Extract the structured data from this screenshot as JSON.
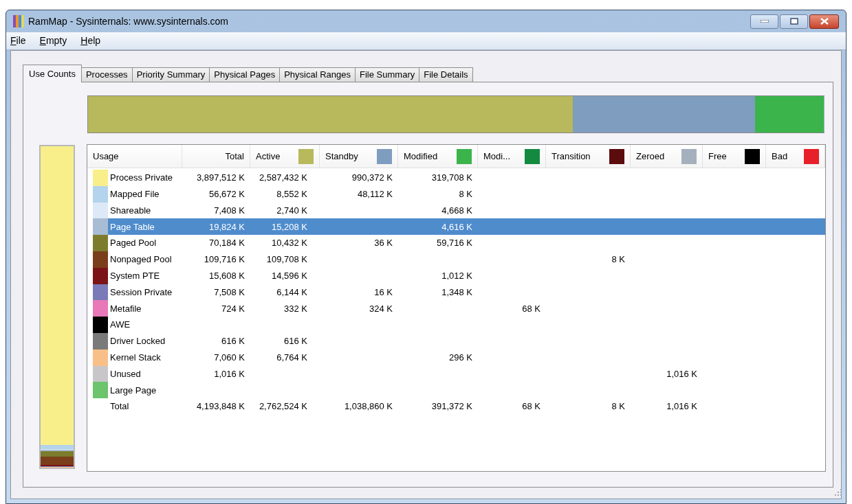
{
  "window": {
    "title": "RamMap - Sysinternals: www.sysinternals.com"
  },
  "menu": [
    "File",
    "Empty",
    "Help"
  ],
  "tabs": [
    {
      "label": "Use Counts",
      "selected": true
    },
    {
      "label": "Processes",
      "selected": false
    },
    {
      "label": "Priority Summary",
      "selected": false
    },
    {
      "label": "Physical Pages",
      "selected": false
    },
    {
      "label": "Physical Ranges",
      "selected": false
    },
    {
      "label": "File Summary",
      "selected": false
    },
    {
      "label": "File Details",
      "selected": false
    }
  ],
  "table": {
    "columns": [
      {
        "label": "Usage"
      },
      {
        "label": "Total"
      },
      {
        "label": "Active",
        "color": "#b8b85c"
      },
      {
        "label": "Standby",
        "color": "#7f9dbf"
      },
      {
        "label": "Modified",
        "color": "#3cb44c"
      },
      {
        "label": "Modi...",
        "color": "#138a3f"
      },
      {
        "label": "Transition",
        "color": "#5c0c0c"
      },
      {
        "label": "Zeroed",
        "color": "#a4b0bc"
      },
      {
        "label": "Free",
        "color": "#000000"
      },
      {
        "label": "Bad",
        "color": "#e8202a"
      }
    ],
    "rows": [
      {
        "usage": "Process Private",
        "color": "#f8ef8a",
        "selected": false,
        "total": "3,897,512 K",
        "active": "2,587,432 K",
        "standby": "990,372 K",
        "modified": "319,708 K"
      },
      {
        "usage": "Mapped File",
        "color": "#b4d3ec",
        "selected": false,
        "total": "56,672 K",
        "active": "8,552 K",
        "standby": "48,112 K",
        "modified": "8 K"
      },
      {
        "usage": "Shareable",
        "color": "#dde9f6",
        "selected": false,
        "total": "7,408 K",
        "active": "2,740 K",
        "modified": "4,668 K"
      },
      {
        "usage": "Page Table",
        "color": "#a8bcd4",
        "selected": true,
        "total": "19,824 K",
        "active": "15,208 K",
        "modified": "4,616 K"
      },
      {
        "usage": "Paged Pool",
        "color": "#7c7c2c",
        "selected": false,
        "total": "70,184 K",
        "active": "10,432 K",
        "standby": "36 K",
        "modified": "59,716 K"
      },
      {
        "usage": "Nonpaged Pool",
        "color": "#7a3f1a",
        "selected": false,
        "total": "109,716 K",
        "active": "109,708 K",
        "transition": "8 K"
      },
      {
        "usage": "System PTE",
        "color": "#7a1416",
        "selected": false,
        "total": "15,608 K",
        "active": "14,596 K",
        "modified": "1,012 K"
      },
      {
        "usage": "Session Private",
        "color": "#7a7ab8",
        "selected": false,
        "total": "7,508 K",
        "active": "6,144 K",
        "standby": "16 K",
        "modified": "1,348 K"
      },
      {
        "usage": "Metafile",
        "color": "#e878b8",
        "selected": false,
        "total": "724 K",
        "active": "332 K",
        "standby": "324 K",
        "column_6": "68 K"
      },
      {
        "usage": "AWE",
        "color": "#000000",
        "selected": false
      },
      {
        "usage": "Driver Locked",
        "color": "#7a7a7a",
        "selected": false,
        "total": "616 K",
        "active": "616 K"
      },
      {
        "usage": "Kernel Stack",
        "color": "#f8c088",
        "selected": false,
        "total": "7,060 K",
        "active": "6,764 K",
        "modified": "296 K"
      },
      {
        "usage": "Unused",
        "color": "#c8c6c8",
        "selected": false,
        "total": "1,016 K",
        "zeroed": "1,016 K"
      },
      {
        "usage": "Large Page",
        "color": "#6cc46c",
        "selected": false
      },
      {
        "usage": "Total",
        "selected": false,
        "total": "4,193,848 K",
        "active": "2,762,524 K",
        "standby": "1,038,860 K",
        "modified": "391,372 K",
        "column_6": "68 K",
        "transition": "8 K",
        "zeroed": "1,016 K"
      }
    ]
  }
}
